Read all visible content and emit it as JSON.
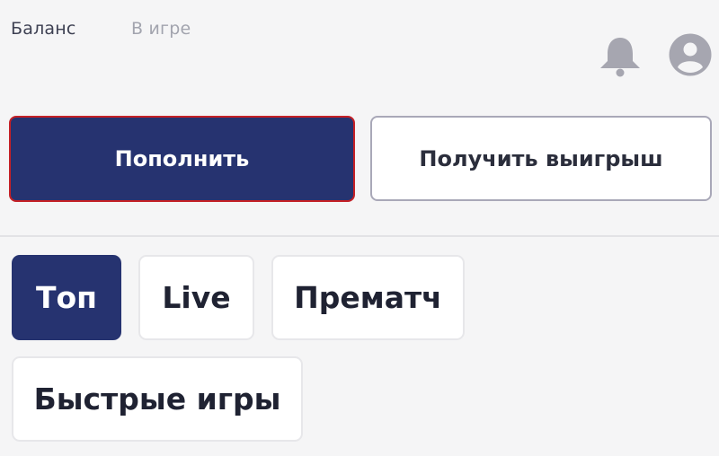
{
  "header": {
    "tabs": [
      {
        "label": "Баланс",
        "active": true
      },
      {
        "label": "В игре",
        "active": false
      }
    ],
    "icons": [
      "bell-icon",
      "user-icon"
    ]
  },
  "actions": {
    "deposit_label": "Пополнить",
    "withdraw_label": "Получить выигрыш"
  },
  "categories": [
    {
      "label": "Топ",
      "active": true
    },
    {
      "label": "Live",
      "active": false
    },
    {
      "label": "Прематч",
      "active": false
    },
    {
      "label": "Быстрые игры",
      "active": false
    }
  ],
  "colors": {
    "accent": "#263370",
    "highlight_border": "#c42026",
    "icon_gray": "#a6a6b0"
  }
}
